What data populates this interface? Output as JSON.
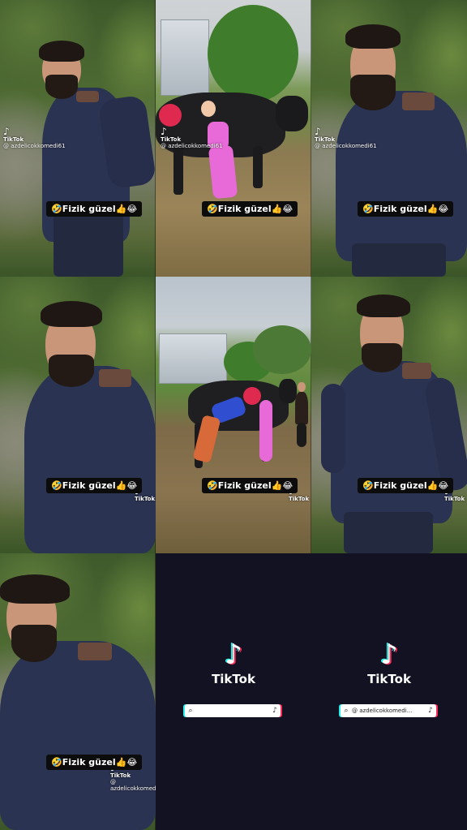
{
  "caption": "🤣Fizik güzel👍😂",
  "watermark": {
    "brand": "TikTok",
    "username": "@ azdelicokkomedi61"
  },
  "end_card": {
    "logo_text": "TikTok",
    "search_empty": "",
    "search_filled": "@ azdelicokkomedi..."
  },
  "icons": {
    "tiktok_note": "♪",
    "search": "⌕"
  },
  "colors": {
    "background": "#121222",
    "accent_cyan": "#25f4ee",
    "accent_red": "#fe2c55"
  }
}
